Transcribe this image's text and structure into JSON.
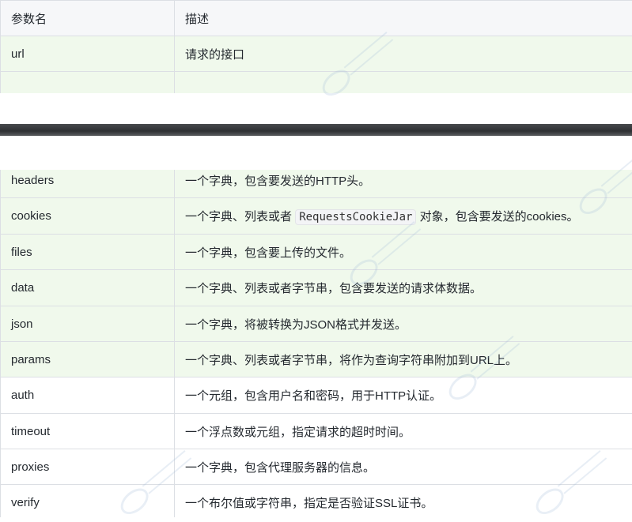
{
  "table": {
    "header": {
      "name": "参数名",
      "desc": "描述"
    },
    "top_rows": [
      {
        "name": "url",
        "desc": "请求的接口"
      },
      {
        "name": "",
        "desc": ""
      }
    ],
    "rows_a": [
      {
        "name": "headers",
        "desc": "一个字典，包含要发送的HTTP头。"
      }
    ],
    "cookies_row": {
      "name": "cookies",
      "desc_before": "一个字典、列表或者",
      "code": "RequestsCookieJar",
      "desc_after": "对象，包含要发送的cookies。"
    },
    "rows_b": [
      {
        "name": "files",
        "desc": "一个字典，包含要上传的文件。"
      },
      {
        "name": "data",
        "desc": "一个字典、列表或者字节串，包含要发送的请求体数据。"
      },
      {
        "name": "json",
        "desc": "一个字典，将被转换为JSON格式并发送。"
      },
      {
        "name": "params",
        "desc": "一个字典、列表或者字节串，将作为查询字符串附加到URL上。"
      },
      {
        "name": "auth",
        "desc": "一个元组，包含用户名和密码，用于HTTP认证。"
      },
      {
        "name": "timeout",
        "desc": "一个浮点数或元组，指定请求的超时时间。"
      },
      {
        "name": "proxies",
        "desc": "一个字典，包含代理服务器的信息。"
      },
      {
        "name": "verify",
        "desc": "一个布尔值或字符串，指定是否验证SSL证书。"
      }
    ]
  },
  "colors": {
    "header_bg": "#f6f7f9",
    "green_row_bg": "#f0f9ec",
    "border": "#dcdfe4",
    "separator": "#2e3033"
  },
  "icons": {
    "watermark": "watermark-logo-icon"
  }
}
